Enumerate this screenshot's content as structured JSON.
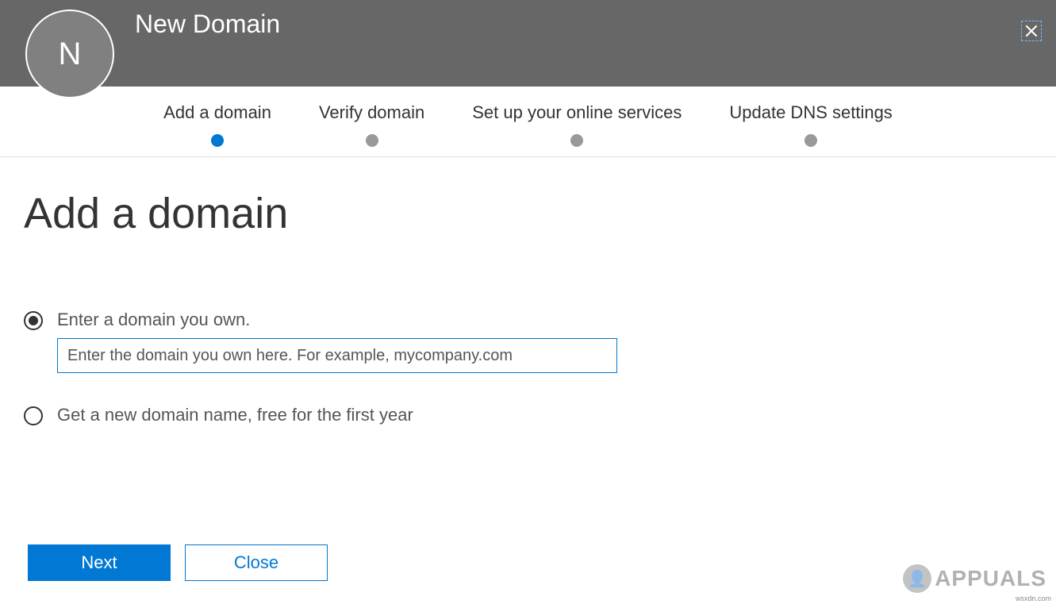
{
  "header": {
    "avatar_letter": "N",
    "title": "New Domain"
  },
  "steps": [
    {
      "label": "Add a domain",
      "active": true
    },
    {
      "label": "Verify domain",
      "active": false
    },
    {
      "label": "Set up your online services",
      "active": false
    },
    {
      "label": "Update DNS settings",
      "active": false
    }
  ],
  "page": {
    "heading": "Add a domain"
  },
  "options": {
    "own": {
      "label": "Enter a domain you own.",
      "placeholder": "Enter the domain you own here. For example, mycompany.com",
      "selected": true
    },
    "new": {
      "label": "Get a new domain name, free for the first year",
      "selected": false
    }
  },
  "buttons": {
    "next": "Next",
    "close": "Close"
  },
  "watermark": {
    "text": "APPUALS",
    "url": "wsxdn.com"
  }
}
